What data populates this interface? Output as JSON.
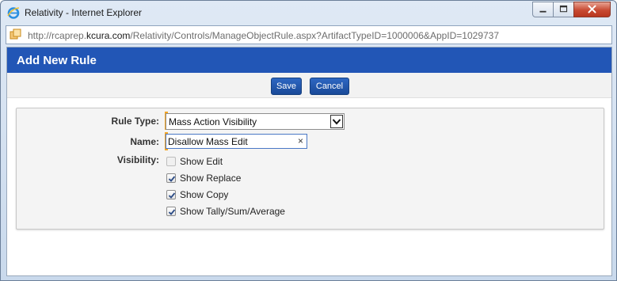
{
  "window": {
    "title": "Relativity - Internet Explorer",
    "address_url_prefix": "http://rcaprep.",
    "address_url_domain": "kcura.com",
    "address_url_suffix": "/Relativity/Controls/ManageObjectRule.aspx?ArtifactTypeID=1000006&AppID=1029737",
    "controls": [
      "minimize",
      "maximize",
      "close"
    ]
  },
  "page": {
    "heading": "Add New Rule",
    "save_label": "Save",
    "cancel_label": "Cancel"
  },
  "form": {
    "rule_type_label": "Rule Type:",
    "rule_type_value": "Mass Action Visibility",
    "name_label": "Name:",
    "name_value": "Disallow Mass Edit",
    "name_clear": "×",
    "visibility_label": "Visibility:",
    "visibility_options": [
      {
        "label": "Show Edit",
        "checked": false,
        "disabled": true
      },
      {
        "label": "Show Replace",
        "checked": true,
        "disabled": false
      },
      {
        "label": "Show Copy",
        "checked": true,
        "disabled": false
      },
      {
        "label": "Show Tally/Sum/Average",
        "checked": true,
        "disabled": false
      }
    ]
  },
  "colors": {
    "header_bg": "#2256b6",
    "button_bg": "#1e54a9",
    "required_marker": "#f5a623"
  }
}
